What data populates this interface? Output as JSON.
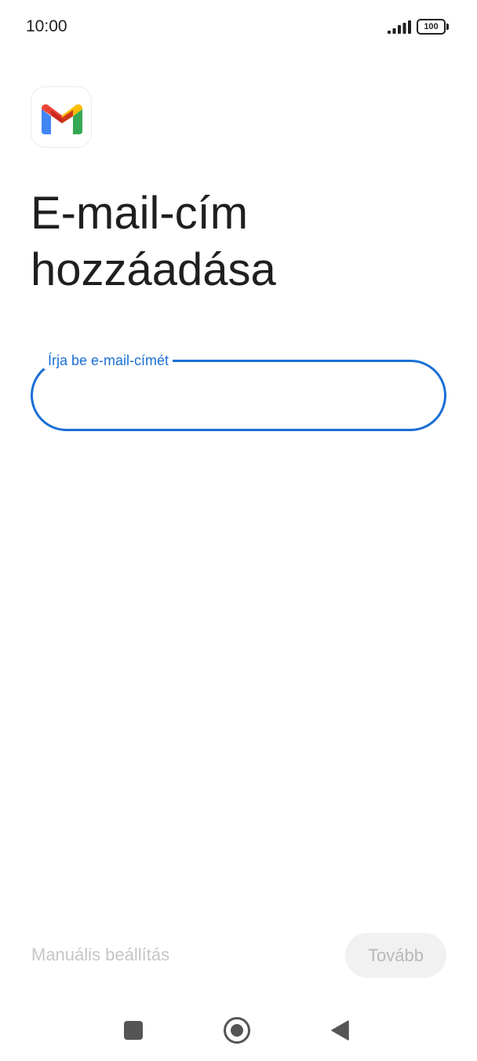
{
  "status_bar": {
    "time": "10:00",
    "battery_level": "100",
    "signal_icon": "signal-bars-icon",
    "battery_icon": "battery-icon"
  },
  "app": {
    "logo_icon": "gmail-logo-icon",
    "colors": {
      "gmail_red": "#EA4335",
      "gmail_blue": "#4285F4",
      "gmail_green": "#34A853",
      "gmail_yellow": "#FBBC04",
      "accent": "#1A6FD6"
    }
  },
  "page": {
    "title_line1": "E-mail-cím",
    "title_line2": "hozzáadása"
  },
  "email_field": {
    "label": "Írja be e-mail-címét",
    "value": ""
  },
  "actions": {
    "manual_setup_label": "Manuális beállítás",
    "next_label": "Tovább"
  },
  "nav_bar": {
    "recents_icon": "square-recents-icon",
    "home_icon": "circle-home-icon",
    "back_icon": "triangle-back-icon"
  }
}
